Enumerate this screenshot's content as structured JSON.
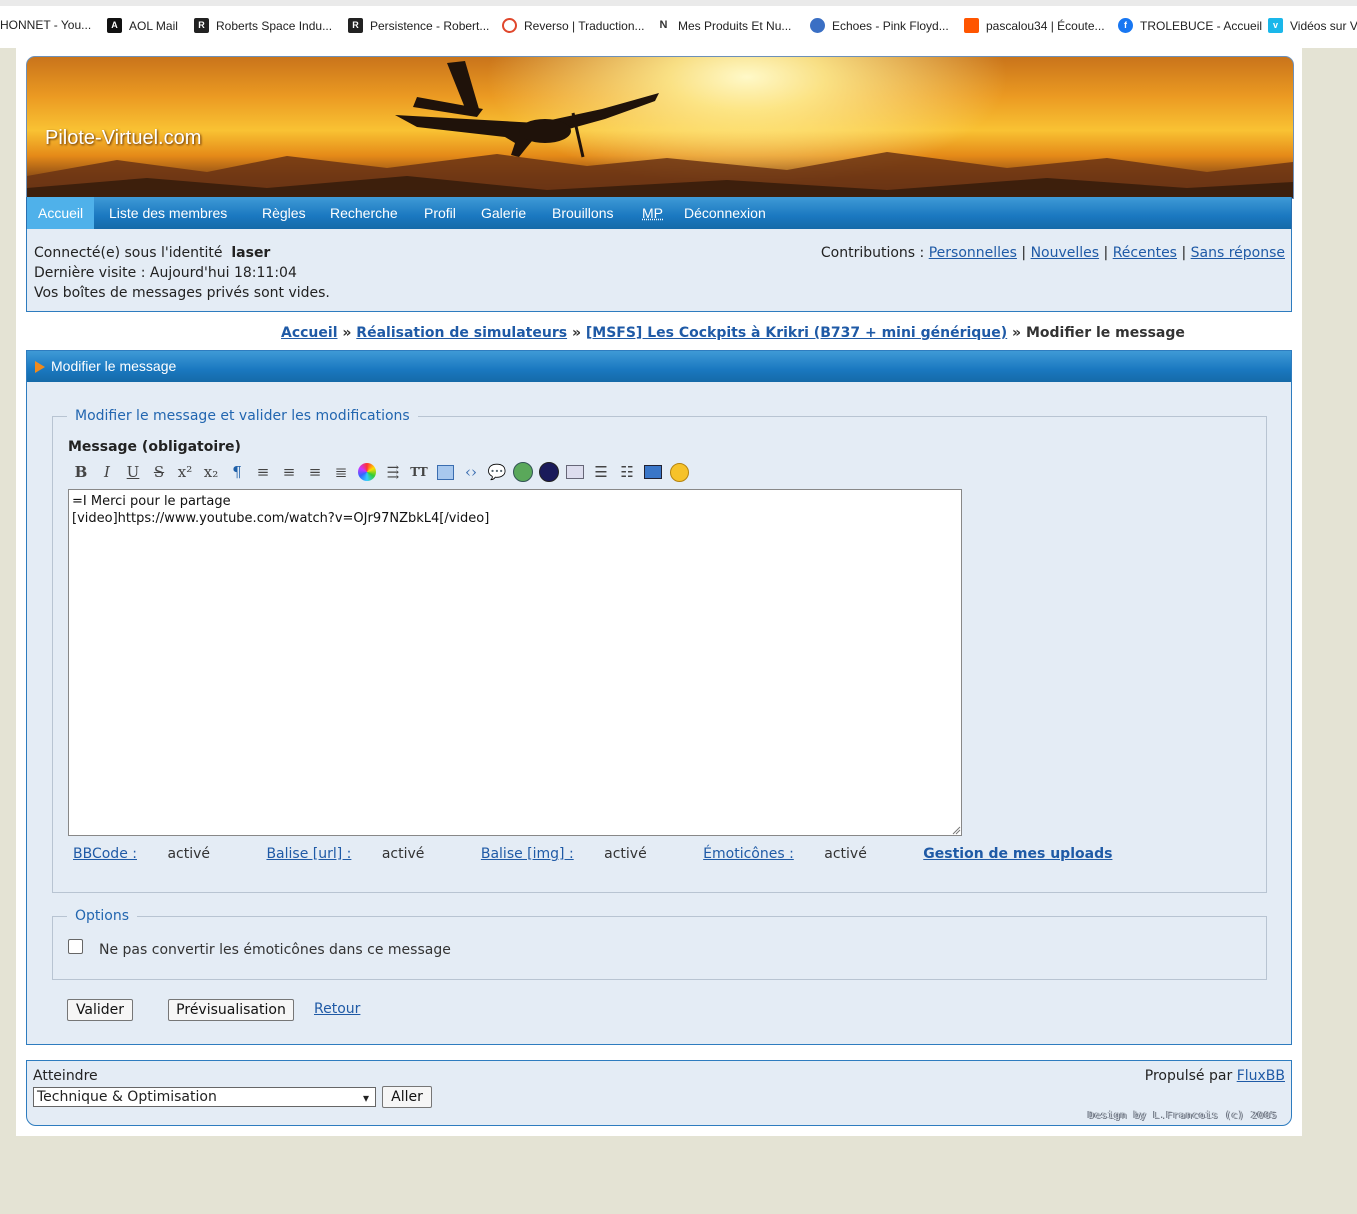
{
  "bookmarks": [
    {
      "label": "HONNET - You...",
      "icon": "none",
      "color": "#ffffff"
    },
    {
      "label": "AOL Mail",
      "icon": "aol-icon",
      "color": "#111111"
    },
    {
      "label": "Roberts Space Indu...",
      "icon": "rsi-icon",
      "color": "#222222"
    },
    {
      "label": "Persistence - Robert...",
      "icon": "rsi-icon",
      "color": "#222222"
    },
    {
      "label": "Reverso | Traduction...",
      "icon": "reverso-icon",
      "color": "#e0472c"
    },
    {
      "label": "Mes Produits Et Nu...",
      "icon": "n-icon",
      "color": "#333333"
    },
    {
      "label": "Echoes - Pink Floyd...",
      "icon": "echoes-icon",
      "color": "#3a6fc4"
    },
    {
      "label": "pascalou34 | Écoute...",
      "icon": "soundcloud-icon",
      "color": "#ff5500"
    },
    {
      "label": "TROLEBUCE - Accueil",
      "icon": "facebook-icon",
      "color": "#1877f2"
    },
    {
      "label": "Vidéos sur V",
      "icon": "vimeo-icon",
      "color": "#1ab7ea"
    }
  ],
  "site": {
    "logo": "Pilote-Virtuel.com"
  },
  "nav": [
    {
      "label": "Accueil",
      "active": true
    },
    {
      "label": "Liste des membres"
    },
    {
      "label": "Règles"
    },
    {
      "label": "Recherche"
    },
    {
      "label": "Profil"
    },
    {
      "label": "Galerie"
    },
    {
      "label": "Brouillons"
    },
    {
      "label": "MP"
    },
    {
      "label": "Déconnexion"
    }
  ],
  "status": {
    "connected_prefix": "Connecté(e) sous l'identité",
    "username": "laser",
    "last_visit": "Dernière visite : Aujourd'hui 18:11:04",
    "pm_info": "Vos boîtes de messages privés sont vides.",
    "contributions_label": "Contributions :",
    "contrib_links": [
      "Personnelles",
      "Nouvelles",
      "Récentes",
      "Sans réponse"
    ],
    "separator": "|"
  },
  "breadcrumb": {
    "items": [
      "Accueil",
      "Réalisation de simulateurs",
      "[MSFS] Les Cockpits à Krikri (B737 + mini générique)"
    ],
    "current": "Modifier le message",
    "sep": "»"
  },
  "panel": {
    "title": "Modifier le message",
    "fieldset_legend": "Modifier le message et valider les modifications",
    "message_label": "Message (obligatoire)",
    "message_text": "=I Merci pour le partage\n[video]https://www.youtube.com/watch?v=OJr97NZbkL4[/video]",
    "toolbar_icons": [
      "bold-icon",
      "italic-icon",
      "underline-icon",
      "strikethrough-icon",
      "superscript-icon",
      "subscript-icon",
      "indent-icon",
      "align-left-icon",
      "align-center-icon",
      "align-right-icon",
      "justify-icon",
      "color-palette-icon",
      "quote-icon",
      "font-size-icon",
      "image-icon",
      "code-icon",
      "speech-bubble-icon",
      "web-icon",
      "media-icon",
      "email-icon",
      "bullet-list-icon",
      "numbered-list-icon",
      "video-tv-icon",
      "smiley-icon"
    ],
    "flags": [
      {
        "label": "BBCode :",
        "value": "activé"
      },
      {
        "label": "Balise [url] :",
        "value": "activé"
      },
      {
        "label": "Balise [img] :",
        "value": "activé"
      },
      {
        "label": "Émoticônes :",
        "value": "activé"
      }
    ],
    "uploads_link": "Gestion de mes uploads",
    "options_legend": "Options",
    "option_no_smilies": "Ne pas convertir les émoticônes dans ce message",
    "option_no_smilies_checked": false,
    "btn_submit": "Valider",
    "btn_preview": "Prévisualisation",
    "link_back": "Retour"
  },
  "footer": {
    "jump_label": "Atteindre",
    "jump_selected": "Technique & Optimisation",
    "go_button": "Aller",
    "powered_by": "Propulsé par",
    "powered_link": "FluxBB",
    "design_credit": "Design by L.Francois (c) 2005"
  },
  "colors": {
    "nav_blue": "#1a78c0",
    "nav_active": "#4fb1ea",
    "link": "#1f5aa6",
    "panel_bg": "#e4ecf5",
    "legend": "#2266b0"
  }
}
